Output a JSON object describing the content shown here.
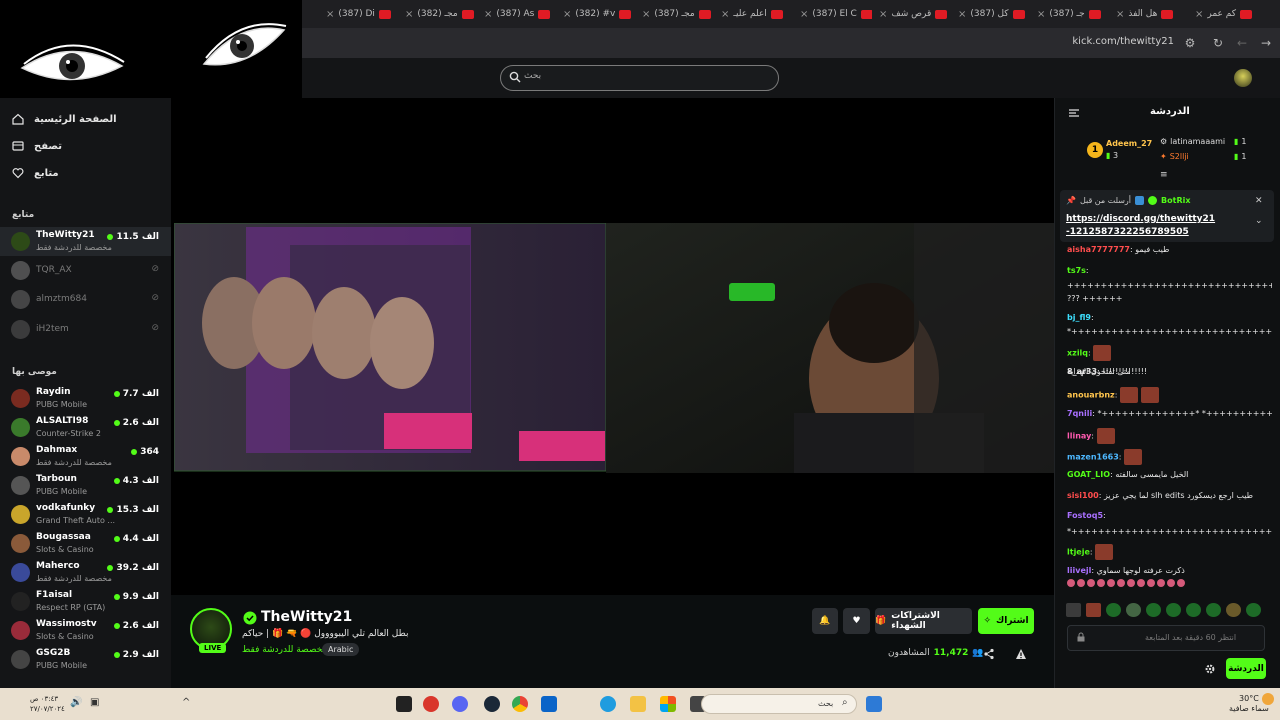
{
  "browser": {
    "tabs": [
      {
        "label": "كم عمر"
      },
      {
        "label": "هل الفذ"
      },
      {
        "label": "(387) جـ"
      },
      {
        "label": "(387) كل"
      },
      {
        "label": "قرص شف"
      },
      {
        "label": "(387) El C"
      },
      {
        "label": "اعلم عليـ"
      },
      {
        "label": "(387) مجـ"
      },
      {
        "label": "(382) #v"
      },
      {
        "label": "(387) As"
      },
      {
        "label": "(382) مجـ"
      },
      {
        "label": "(387) Di"
      }
    ],
    "url": "kick.com/thewitty21"
  },
  "header": {
    "search_placeholder": "بحث"
  },
  "sidebar": {
    "nav": [
      {
        "label": "الصفحة الرئيسية"
      },
      {
        "label": "تصفح"
      },
      {
        "label": "متابع"
      }
    ],
    "following_title": "متابع",
    "following": [
      {
        "name": "TheWitty21",
        "sub": "مخصصة للدردشة فقط",
        "viewers": "11.5 الف",
        "online": true
      },
      {
        "name": "TQR_AX",
        "online": false
      },
      {
        "name": "almztm684",
        "online": false
      },
      {
        "name": "iH2tem",
        "online": false
      }
    ],
    "recommended_title": "موصى بها",
    "recommended": [
      {
        "name": "Raydin",
        "sub": "PUBG Mobile",
        "viewers": "7.7 الف"
      },
      {
        "name": "ALSALTI98",
        "sub": "Counter-Strike 2",
        "viewers": "2.6 الف"
      },
      {
        "name": "Dahmax",
        "sub": "مخصصة للدردشة فقط",
        "viewers": "364"
      },
      {
        "name": "Tarboun",
        "sub": "PUBG Mobile",
        "viewers": "4.3 الف"
      },
      {
        "name": "vodkafunky",
        "sub": "Grand Theft Auto ...",
        "viewers": "15.3 الف"
      },
      {
        "name": "Bougassaa",
        "sub": "Slots & Casino",
        "viewers": "4.4 الف"
      },
      {
        "name": "Maherco",
        "sub": "مخصصة للدردشة فقط",
        "viewers": "39.2 الف"
      },
      {
        "name": "F1aisal",
        "sub": "Respect RP (GTA)",
        "viewers": "9.9 الف"
      },
      {
        "name": "Wassimostv",
        "sub": "Slots & Casino",
        "viewers": "2.6 الف"
      },
      {
        "name": "GSG2B",
        "sub": "PUBG Mobile",
        "viewers": "2.9 الف"
      }
    ]
  },
  "stream": {
    "name": "TheWitty21",
    "live": "LIVE",
    "title": "بطل العالم تلي اليبوووول 🔴 🔫 🎁 | حياكم",
    "category": "مخصصة للدردشة فقط",
    "language": "Arabic",
    "subscribe": "اشتراك",
    "gift": "الاشتراكات الشهداء",
    "viewers_label": "المشاهدون",
    "viewers": "11,472"
  },
  "chat": {
    "title": "الدردشة",
    "leaderboard": [
      {
        "name": "Adeem_27",
        "count": "3"
      },
      {
        "name": "latinamaaami",
        "count": "1"
      },
      {
        "name": "S2llji",
        "count": "1"
      }
    ],
    "pinned": {
      "by_label": "أرسلت من قبل",
      "author": "BotRix",
      "link": "https://discord.gg/thewitty21-1212587322256789505"
    },
    "messages": [
      {
        "user": "aisha7777777",
        "text": "طيب فيمو",
        "color": "#ff4d4d"
      },
      {
        "user": "ts7s",
        "text": "",
        "color": "#53fc18"
      },
      {
        "user": "",
        "text": "+++++++++++++++++++++++++++++++++++++++",
        "color": "#e6e6e6"
      },
      {
        "user": "",
        "text": "??? ++++++",
        "color": "#e6e6e6"
      },
      {
        "user": "bj_fl9",
        "text": "",
        "color": "#3de0ff"
      },
      {
        "user": "",
        "text": "*++++++++++++++++++++++++++++++++++++++*",
        "color": "#e6e6e6"
      },
      {
        "user": "xzilq",
        "text": "",
        "color": "#53fc18"
      },
      {
        "user": "",
        "text": "متى تفتحون الهداية",
        "color": "#e6e6e6"
      },
      {
        "user": "8_ar33",
        "text": "!!!!!!!!!!!!!!",
        "color": "#e6e6e6"
      },
      {
        "user": "anouarbnz",
        "text": "",
        "color": "#ffc54d"
      },
      {
        "user": "7qnili",
        "text": "*++++++++++++++* *++++++++++++++*",
        "color": "#a970ff"
      },
      {
        "user": "llinay",
        "text": "",
        "color": "#ff5ab0"
      },
      {
        "user": "mazen1663",
        "text": "",
        "color": "#4db8ff"
      },
      {
        "user": "GOAT_LIO",
        "text": "الخيل مايمسى سالفته",
        "color": "#53fc18"
      },
      {
        "user": "sisi100",
        "text": "لما يجي عزيز slh edits طيب ارجع ديسكورد",
        "color": "#ff4d4d"
      },
      {
        "user": "Fostoq5",
        "text": "",
        "color": "#a970ff"
      },
      {
        "user": "",
        "text": "*++++++++++++++++++++++++++++++++++++*",
        "color": "#e6e6e6"
      },
      {
        "user": "ltjeje",
        "text": "",
        "color": "#53fc18"
      },
      {
        "user": "liivejl",
        "text": "ذكرت عرفته لوجها سماوي",
        "color": "#a970ff"
      }
    ],
    "input_placeholder": "انتظر 60 دقيقة بعد المتابعة",
    "send": "الدردشة"
  },
  "taskbar": {
    "search_placeholder": "بحث",
    "time": "٠٣:٤٣ ص",
    "date": "٢٧/٠٧/٢٠٢٤",
    "temp": "30°C",
    "weather": "سماء صافية"
  },
  "colors": {
    "accent": "#53fc18",
    "bg": "#0b0e0f",
    "panel": "#141517"
  }
}
